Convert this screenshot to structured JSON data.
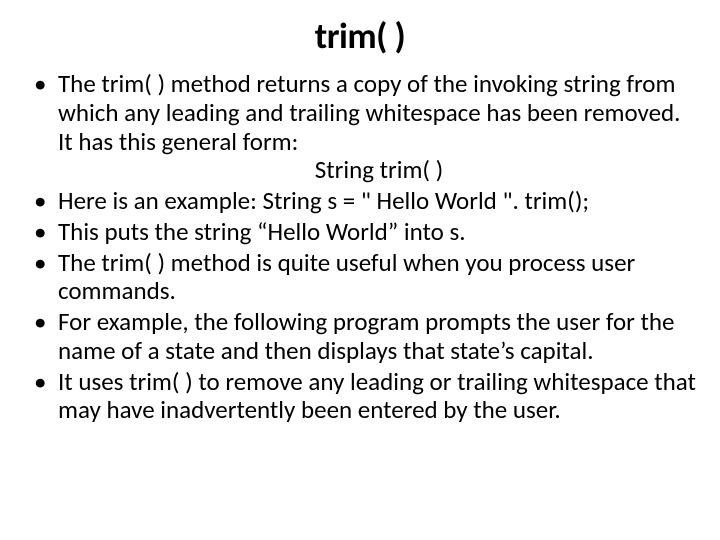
{
  "title": "trim( )",
  "bullets": {
    "b0_pre": "The trim( ) method returns a copy of the invoking string from which any leading and trailing whitespace has been removed. It has this general form:",
    "b0_sub": "String trim( )",
    "b1": "Here is an example: String s = \" Hello World \". trim();",
    "b2": "This puts the string “Hello World” into s.",
    "b3": "The trim( ) method is quite useful when you process user commands.",
    "b4": "For example, the following program prompts the user for the name of a state and then displays that state’s capital.",
    "b5": "It uses trim( ) to remove any leading or trailing whitespace that may have inadvertently been entered by the user."
  }
}
